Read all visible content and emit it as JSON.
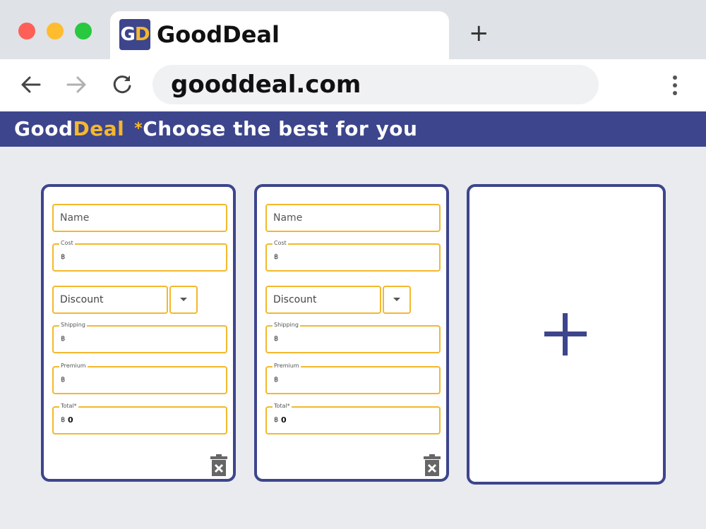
{
  "browser": {
    "tab_logo": {
      "g": "G",
      "d": "D"
    },
    "tab_title": "GoodDeal",
    "new_tab": "+",
    "url": "gooddeal.com"
  },
  "header": {
    "brand_good": "Good",
    "brand_deal": "Deal",
    "star": "*",
    "tagline": "Choose the best for you"
  },
  "cards": [
    {
      "name_placeholder": "Name",
      "cost_label": "Cost",
      "currency": "฿",
      "discount_placeholder": "Discount",
      "shipping_label": "Shipping",
      "premium_label": "Premium",
      "total_label": "Total*",
      "total_value": "0"
    },
    {
      "name_placeholder": "Name",
      "cost_label": "Cost",
      "currency": "฿",
      "discount_placeholder": "Discount",
      "shipping_label": "Shipping",
      "premium_label": "Premium",
      "total_label": "Total*",
      "total_value": "0"
    }
  ],
  "icons": {
    "back": "arrow-left-icon",
    "forward": "arrow-right-icon",
    "reload": "reload-icon",
    "menu": "more-vertical-icon",
    "delete": "trash-icon",
    "add": "plus-icon"
  },
  "colors": {
    "primary": "#3d458c",
    "accent": "#f4b82d",
    "background": "#e9ebef"
  }
}
